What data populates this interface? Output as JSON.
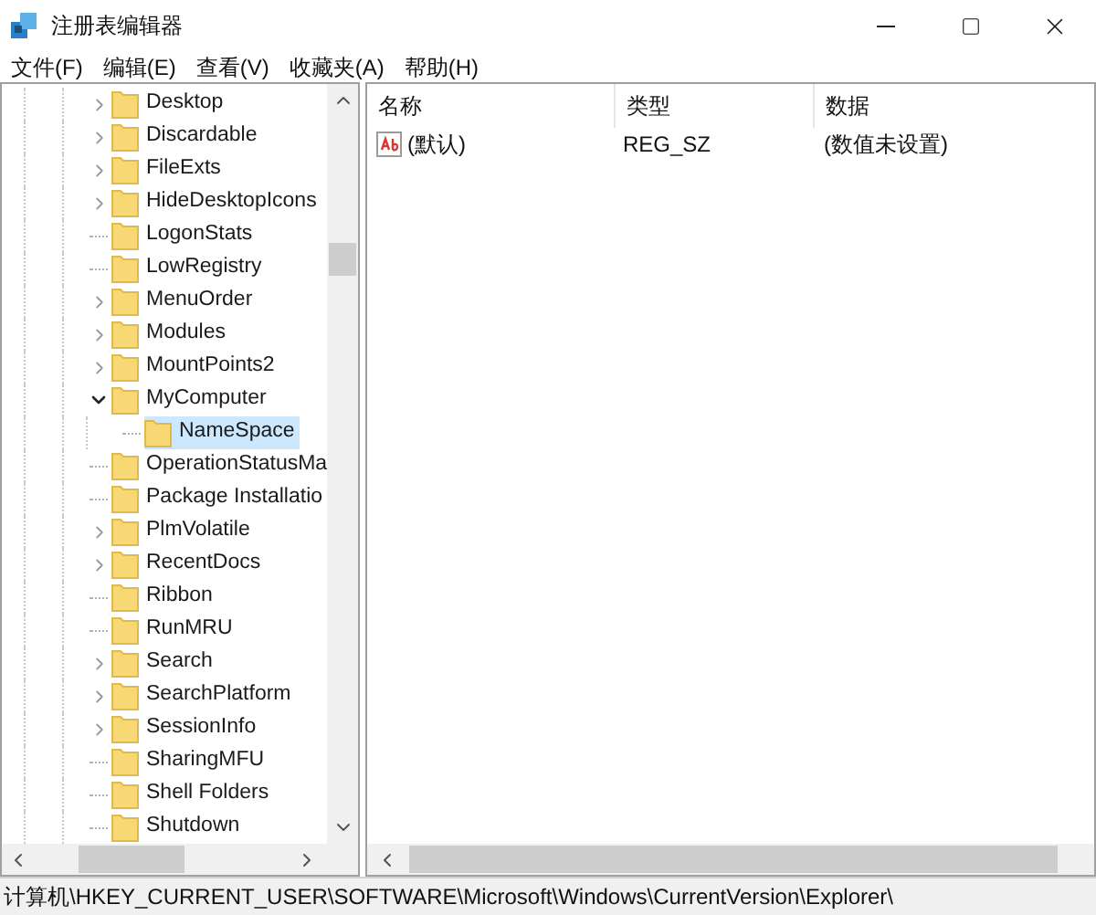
{
  "window": {
    "title": "注册表编辑器"
  },
  "menu": [
    "文件(F)",
    "编辑(E)",
    "查看(V)",
    "收藏夹(A)",
    "帮助(H)"
  ],
  "tree": [
    {
      "name": "Desktop",
      "expandable": true,
      "expanded": false,
      "selected": false
    },
    {
      "name": "Discardable",
      "expandable": true,
      "expanded": false,
      "selected": false
    },
    {
      "name": "FileExts",
      "expandable": true,
      "expanded": false,
      "selected": false
    },
    {
      "name": "HideDesktopIcons",
      "expandable": true,
      "expanded": false,
      "selected": false
    },
    {
      "name": "LogonStats",
      "expandable": false,
      "selected": false
    },
    {
      "name": "LowRegistry",
      "expandable": false,
      "selected": false
    },
    {
      "name": "MenuOrder",
      "expandable": true,
      "expanded": false,
      "selected": false
    },
    {
      "name": "Modules",
      "expandable": true,
      "expanded": false,
      "selected": false
    },
    {
      "name": "MountPoints2",
      "expandable": true,
      "expanded": false,
      "selected": false
    },
    {
      "name": "MyComputer",
      "expandable": true,
      "expanded": true,
      "selected": false,
      "children": [
        {
          "name": "NameSpace",
          "expandable": false,
          "selected": true
        }
      ]
    },
    {
      "name": "OperationStatusMa",
      "expandable": false,
      "selected": false
    },
    {
      "name": "Package Installatio",
      "expandable": false,
      "selected": false
    },
    {
      "name": "PlmVolatile",
      "expandable": true,
      "expanded": false,
      "selected": false
    },
    {
      "name": "RecentDocs",
      "expandable": true,
      "expanded": false,
      "selected": false
    },
    {
      "name": "Ribbon",
      "expandable": false,
      "selected": false
    },
    {
      "name": "RunMRU",
      "expandable": false,
      "selected": false
    },
    {
      "name": "Search",
      "expandable": true,
      "expanded": false,
      "selected": false
    },
    {
      "name": "SearchPlatform",
      "expandable": true,
      "expanded": false,
      "selected": false
    },
    {
      "name": "SessionInfo",
      "expandable": true,
      "expanded": false,
      "selected": false
    },
    {
      "name": "SharingMFU",
      "expandable": false,
      "selected": false
    },
    {
      "name": "Shell Folders",
      "expandable": false,
      "selected": false
    },
    {
      "name": "Shutdown",
      "expandable": false,
      "selected": false
    }
  ],
  "values_table": {
    "columns": [
      "名称",
      "类型",
      "数据"
    ],
    "rows": [
      {
        "name": "(默认)",
        "type": "REG_SZ",
        "data": "(数值未设置)"
      }
    ]
  },
  "status_bar": "计算机\\HKEY_CURRENT_USER\\SOFTWARE\\Microsoft\\Windows\\CurrentVersion\\Explorer\\"
}
